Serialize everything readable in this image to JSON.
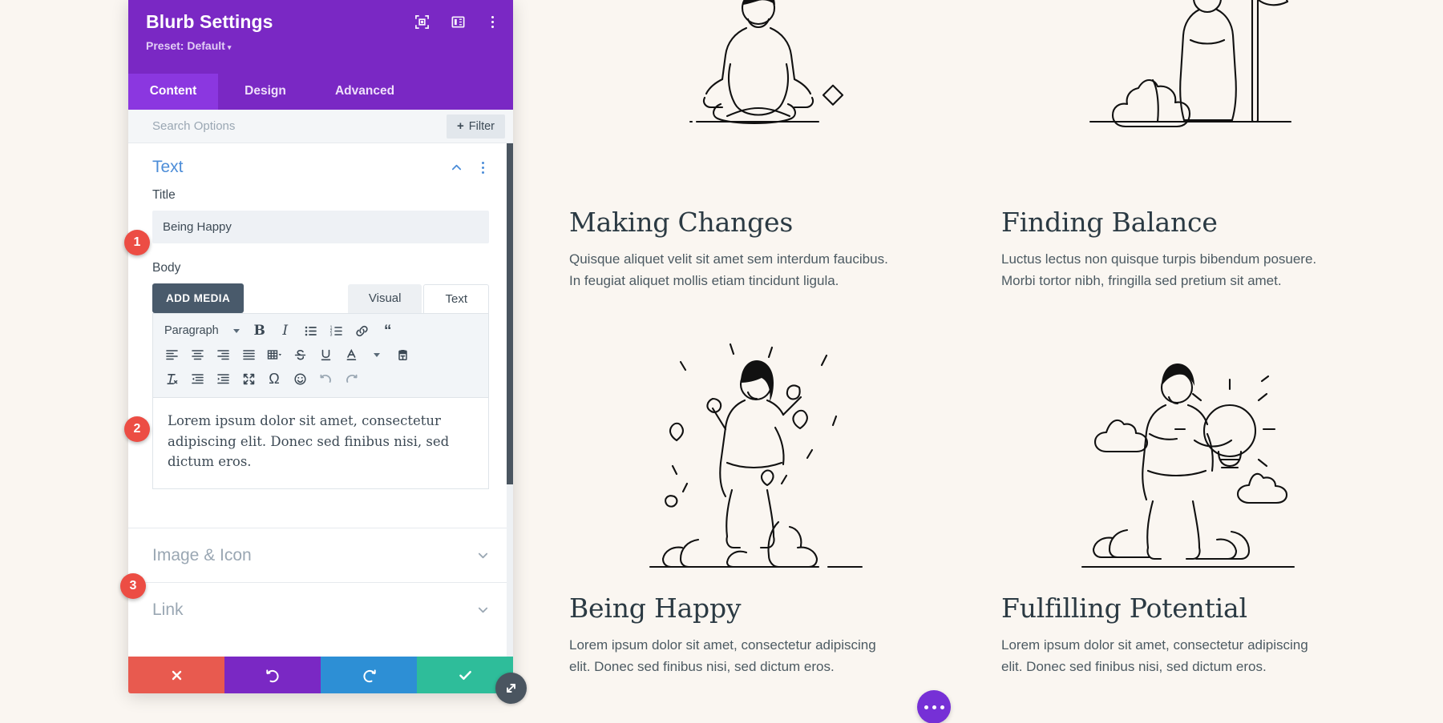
{
  "modal": {
    "title": "Blurb Settings",
    "preset_label": "Preset: Default",
    "header_icons": [
      "focus-target-icon",
      "layout-panel-icon",
      "more-vertical-icon"
    ],
    "tabs": [
      {
        "label": "Content",
        "active": true
      },
      {
        "label": "Design",
        "active": false
      },
      {
        "label": "Advanced",
        "active": false
      }
    ],
    "search": {
      "placeholder": "Search Options",
      "value": "",
      "filter_label": "Filter",
      "filter_plus": "+"
    },
    "sections": [
      {
        "name": "Text",
        "state": "expanded",
        "color": "#4c8dd8"
      },
      {
        "name": "Image & Icon",
        "state": "collapsed",
        "color": "#9aa7b3"
      },
      {
        "name": "Link",
        "state": "collapsed",
        "color": "#9aa7b3"
      }
    ],
    "text_section": {
      "heading": "Text",
      "title_label": "Title",
      "title_value": "Being Happy",
      "body_label": "Body",
      "add_media_label": "ADD MEDIA",
      "editor_tabs": [
        {
          "label": "Visual",
          "active": false
        },
        {
          "label": "Text",
          "active": true
        }
      ],
      "format_select": "Paragraph",
      "toolbar_row1": [
        "format-select",
        "bold-icon",
        "italic-icon",
        "bulleted-list-icon",
        "numbered-list-icon",
        "link-icon",
        "blockquote-icon"
      ],
      "toolbar_row2": [
        "align-left-icon",
        "align-center-icon",
        "align-right-icon",
        "align-justify-icon",
        "table-icon",
        "strikethrough-icon",
        "underline-icon",
        "text-color-icon",
        "paste-as-text-icon"
      ],
      "toolbar_row3": [
        "clear-formatting-icon",
        "outdent-icon",
        "indent-icon",
        "fullscreen-icon",
        "special-character-icon",
        "emoji-icon",
        "undo-icon",
        "redo-icon"
      ],
      "body_value": "Lorem ipsum dolor sit amet, consectetur adipiscing elit. Donec sed finibus nisi, sed dictum eros."
    },
    "image_icon_section_label": "Image & Icon",
    "link_section_label": "Link",
    "footer": [
      {
        "name": "cancel",
        "icon": "close-icon",
        "color": "#e85a4f"
      },
      {
        "name": "undo",
        "icon": "undo-icon",
        "color": "#7a28c4"
      },
      {
        "name": "redo",
        "icon": "redo-icon",
        "color": "#2d8fd5"
      },
      {
        "name": "save",
        "icon": "check-icon",
        "color": "#2ebd9a"
      }
    ],
    "resize_handle_icon": "resize-diagonal-icon"
  },
  "badges": [
    {
      "number": "1",
      "target": "title-field"
    },
    {
      "number": "2",
      "target": "body-editor"
    },
    {
      "number": "3",
      "target": "image-icon-section"
    }
  ],
  "page": {
    "background": "#faf6f1",
    "fab_icon": "more-horizontal-icon",
    "blurbs": [
      {
        "art": "meditating-person-illustration",
        "title": "Making Changes",
        "body": "Quisque aliquet velit sit amet sem interdum faucibus. In feugiat aliquet mollis etiam tincidunt ligula."
      },
      {
        "art": "person-with-plant-illustration",
        "title": "Finding Balance",
        "body": "Luctus lectus non quisque turpis bibendum posuere. Morbi tortor nibh, fringilla sed pretium sit amet."
      },
      {
        "art": "celebrating-person-illustration",
        "title": "Being Happy",
        "body": "Lorem ipsum dolor sit amet, consectetur adipiscing elit. Donec sed finibus nisi, sed dictum eros."
      },
      {
        "art": "person-holding-lightbulb-illustration",
        "title": "Fulfilling Potential",
        "body": "Lorem ipsum dolor sit amet, consectetur adipiscing elit. Donec sed finibus nisi, sed dictum eros."
      }
    ]
  }
}
